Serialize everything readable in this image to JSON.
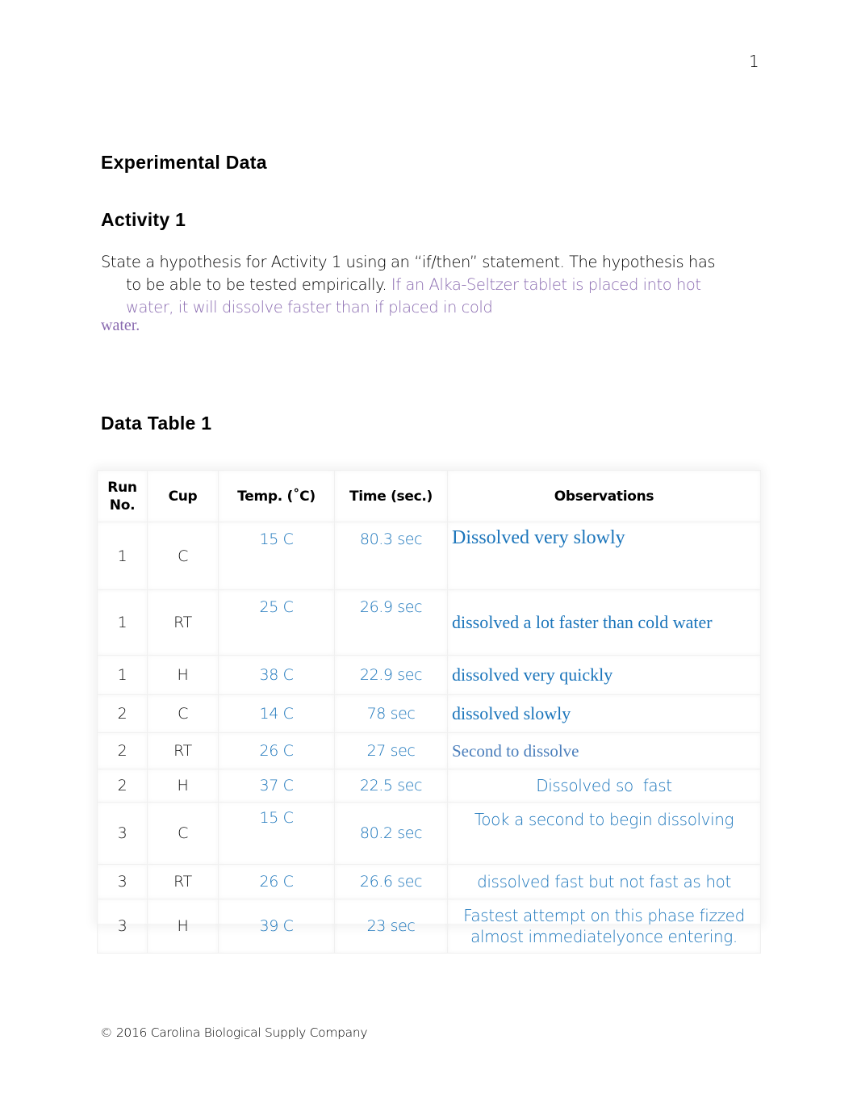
{
  "page_number": "1",
  "headings": {
    "experimental_data": "Experimental Data",
    "activity": "Activity 1",
    "data_table": "Data Table 1"
  },
  "hypothesis": {
    "prompt_line1": "State a hypothesis for Activity 1 using an “if/then” statement. The hypothesis has",
    "prompt_line2": "to be able to be tested empirically. ",
    "answer_line1": "If an Alka-Seltzer tablet is placed into hot",
    "answer_line2": "water, it will dissolve faster than if placed in cold",
    "answer_line3": "water.",
    "answer_color": "#8a6bb0"
  },
  "table": {
    "headers": {
      "run": "Run No.",
      "cup": "Cup",
      "temp": "Temp. (˚C)",
      "time": "Time (sec.)",
      "obs": "Observations"
    },
    "entry_color": "#1b75bb",
    "rows": [
      {
        "run": "1",
        "cup": "C",
        "temp": "15 C",
        "time": "80.3 sec",
        "obs": "Dissolved very slowly"
      },
      {
        "run": "1",
        "cup": "RT",
        "temp": "25 C",
        "time": "26.9 sec",
        "obs": "dissolved a lot faster than cold water"
      },
      {
        "run": "1",
        "cup": "H",
        "temp": "38 C",
        "time": "22.9 sec",
        "obs": "dissolved very quickly"
      },
      {
        "run": "2",
        "cup": "C",
        "temp": "14 C",
        "time": "78 sec",
        "obs": "dissolved slowly"
      },
      {
        "run": "2",
        "cup": "RT",
        "temp": "26 C",
        "time": "27 sec",
        "obs": "Second to dissolve"
      },
      {
        "run": "2",
        "cup": "H",
        "temp": "37 C",
        "time": "22.5 sec",
        "obs": "Dissolved so  fast"
      },
      {
        "run": "3",
        "cup": "C",
        "temp": "15 C",
        "time": "80.2 sec",
        "obs": "Took a second to begin dissolving"
      },
      {
        "run": "3",
        "cup": "RT",
        "temp": "26 C",
        "time": "26.6 sec",
        "obs": "dissolved fast but not fast as hot"
      },
      {
        "run": "3",
        "cup": "H",
        "temp": "39 C",
        "time": "23 sec",
        "obs": "Fastest attempt on this phase fizzed almost immediatelyonce entering."
      }
    ]
  },
  "footer": "© 2016 Carolina Biological Supply Company"
}
